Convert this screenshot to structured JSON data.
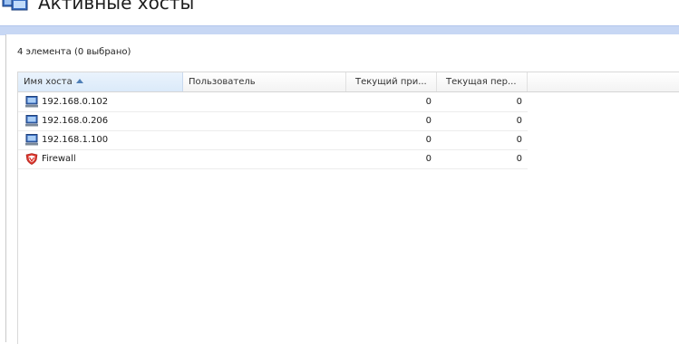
{
  "header": {
    "title": "Активные хосты",
    "icon": "hosts-icon"
  },
  "panel": {
    "count_text": "4 элемента (0 выбрано)"
  },
  "columns": [
    {
      "label": "Имя хоста",
      "sorted": "ascending"
    },
    {
      "label": "Пользователь"
    },
    {
      "label": "Текущий при..."
    },
    {
      "label": "Текущая пер..."
    }
  ],
  "rows": [
    {
      "host": "192.168.0.102",
      "icon": "computer-icon",
      "user": "",
      "col3": "0",
      "col4": "0"
    },
    {
      "host": "192.168.0.206",
      "icon": "computer-icon",
      "user": "",
      "col3": "0",
      "col4": "0"
    },
    {
      "host": "192.168.1.100",
      "icon": "computer-icon",
      "user": "",
      "col3": "0",
      "col4": "0"
    },
    {
      "host": "Firewall",
      "icon": "firewall-shield-icon",
      "user": "",
      "col3": "0",
      "col4": "0"
    }
  ],
  "colors": {
    "accent_band": "#c7d7f4",
    "sorted_header": "#dbeafa",
    "firewall_icon": "#d9342b"
  }
}
